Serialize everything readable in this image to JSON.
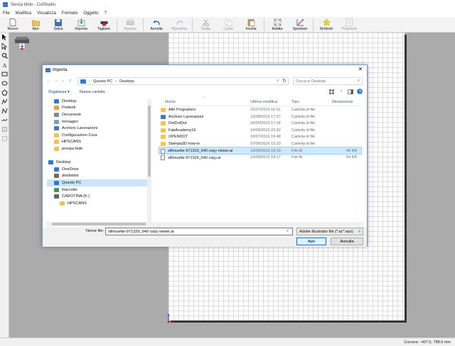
{
  "window": {
    "title": "Senza titolo - CutStudio"
  },
  "menu": [
    "File",
    "Modifica",
    "Visualizza",
    "Formato",
    "Oggetto",
    "?"
  ],
  "toolbar": [
    {
      "label": "Nuovo",
      "icon": "new-document-icon",
      "disabled": false
    },
    {
      "label": "Apri",
      "icon": "open-folder-icon",
      "disabled": false
    },
    {
      "label": "Salva",
      "icon": "save-icon",
      "disabled": false
    },
    {
      "label": "Importa",
      "icon": "import-icon",
      "disabled": false
    },
    {
      "label": "Tagliare",
      "icon": "cut-machine-icon",
      "disabled": false
    },
    {
      "label": "Stampa",
      "icon": "print-icon",
      "disabled": true
    },
    {
      "label": "Annulla",
      "icon": "undo-icon",
      "disabled": false
    },
    {
      "label": "Ripristina",
      "icon": "redo-icon",
      "disabled": true
    },
    {
      "label": "Taglia",
      "icon": "scissors-icon",
      "disabled": true
    },
    {
      "label": "Copia",
      "icon": "copy-icon",
      "disabled": true
    },
    {
      "label": "Incolla",
      "icon": "paste-icon",
      "disabled": false
    },
    {
      "label": "Adatta",
      "icon": "fit-icon",
      "disabled": false
    },
    {
      "label": "Spostare",
      "icon": "move-icon",
      "disabled": false
    },
    {
      "label": "Simbolo",
      "icon": "star-icon",
      "disabled": false
    },
    {
      "label": "Proprietà",
      "icon": "properties-icon",
      "disabled": true
    }
  ],
  "statusbar": {
    "cursor": "Cursore: -407.5, 788.6 mm"
  },
  "dialog": {
    "title": "Importa",
    "path": [
      "Questo PC",
      "Desktop"
    ],
    "search_placeholder": "Cerca in Desktop",
    "organize": "Organizza ▾",
    "new_folder": "Nuova cartella",
    "nav_items": [
      {
        "label": "Desktop",
        "icon": "desktop-icon",
        "color": "#2b7bd3",
        "pinned": true,
        "indent": 1,
        "selected": false
      },
      {
        "label": "Preferiti",
        "icon": "star-folder-icon",
        "color": "#e8a033",
        "pinned": true,
        "indent": 1,
        "selected": false
      },
      {
        "label": "Documenti",
        "icon": "documents-icon",
        "color": "#8a8a8a",
        "pinned": true,
        "indent": 1,
        "selected": false
      },
      {
        "label": "Immagini",
        "icon": "pictures-icon",
        "color": "#6aa3d8",
        "pinned": true,
        "indent": 1,
        "selected": false
      },
      {
        "label": "Archivio Lavorazioni",
        "icon": "archive-icon",
        "color": "#4a78b8",
        "pinned": false,
        "indent": 1,
        "selected": false
      },
      {
        "label": "Configurazioni Cura",
        "icon": "folder-icon",
        "color": "#f3c453",
        "pinned": false,
        "indent": 1,
        "selected": false
      },
      {
        "label": "HPSCANS",
        "icon": "folder-icon",
        "color": "#f3c453",
        "pinned": false,
        "indent": 1,
        "selected": false
      },
      {
        "label": "prespa fede",
        "icon": "folder-icon",
        "color": "#f3c453",
        "pinned": false,
        "indent": 1,
        "selected": false
      },
      {
        "label": "",
        "icon": "",
        "color": "",
        "pinned": false,
        "indent": 0,
        "selected": false
      },
      {
        "label": "Desktop",
        "icon": "desktop-icon",
        "color": "#2b7bd3",
        "pinned": false,
        "indent": 0,
        "selected": false
      },
      {
        "label": "OneDrive",
        "icon": "onedrive-icon",
        "color": "#2b7bd3",
        "pinned": false,
        "indent": 1,
        "selected": false
      },
      {
        "label": "dotdotdot",
        "icon": "user-icon",
        "color": "#7a6a55",
        "pinned": false,
        "indent": 1,
        "selected": false
      },
      {
        "label": "Questo PC",
        "icon": "pc-icon",
        "color": "#2b7bd3",
        "pinned": false,
        "indent": 1,
        "selected": true
      },
      {
        "label": "Raccolte",
        "icon": "libraries-icon",
        "color": "#3c9a5f",
        "pinned": false,
        "indent": 1,
        "selected": false
      },
      {
        "label": "CAROTINA (K:)",
        "icon": "usb-drive-icon",
        "color": "#666666",
        "pinned": false,
        "indent": 1,
        "selected": false
      },
      {
        "label": "HPSCANS",
        "icon": "folder-icon",
        "color": "#f3c453",
        "pinned": false,
        "indent": 2,
        "selected": false
      }
    ],
    "columns": {
      "name": "Nome",
      "date": "Ultima modifica",
      "type": "Tipo",
      "size": "Dimensione"
    },
    "files": [
      {
        "name": "Altri Programmi",
        "date": "21/07/2016 16:01",
        "type": "Cartella di file",
        "size": "",
        "kind": "folder",
        "selected": false
      },
      {
        "name": "Archivio Lavorazioni",
        "date": "13/08/2016 17:57",
        "type": "Cartella di file",
        "size": "",
        "kind": "special",
        "selected": false
      },
      {
        "name": "DotDotDot",
        "date": "26/05/2016 17:24",
        "type": "Cartella di file",
        "size": "",
        "kind": "folder",
        "selected": false
      },
      {
        "name": "FabAcademy16",
        "date": "14/06/2016 22:42",
        "type": "Cartella di file",
        "size": "",
        "kind": "folder",
        "selected": false
      },
      {
        "name": "OPENDOT",
        "date": "19/07/2016 19:48",
        "type": "Cartella di file",
        "size": "",
        "kind": "folder",
        "selected": false
      },
      {
        "name": "Stampa3D how-to",
        "date": "07/06/2016 15:10",
        "type": "Cartella di file",
        "size": "",
        "kind": "folder",
        "selected": false
      },
      {
        "name": "silhouette-971329_640 copy newer.ai",
        "date": "13/08/2016 19:19",
        "type": "File AI",
        "size": "46 KB",
        "kind": "file",
        "selected": true
      },
      {
        "name": "silhouette-971329_640 copy.ai",
        "date": "13/08/2016 18:17",
        "type": "File AI",
        "size": "54 KB",
        "kind": "file",
        "selected": false
      }
    ],
    "filename_label": "Nome file:",
    "filename_value": "silhouette-971329_640 copy newer.ai",
    "filter": "Adobe Illustrator file (*.ai;*.eps)",
    "open_button": "Apri",
    "cancel_button": "Annulla"
  }
}
